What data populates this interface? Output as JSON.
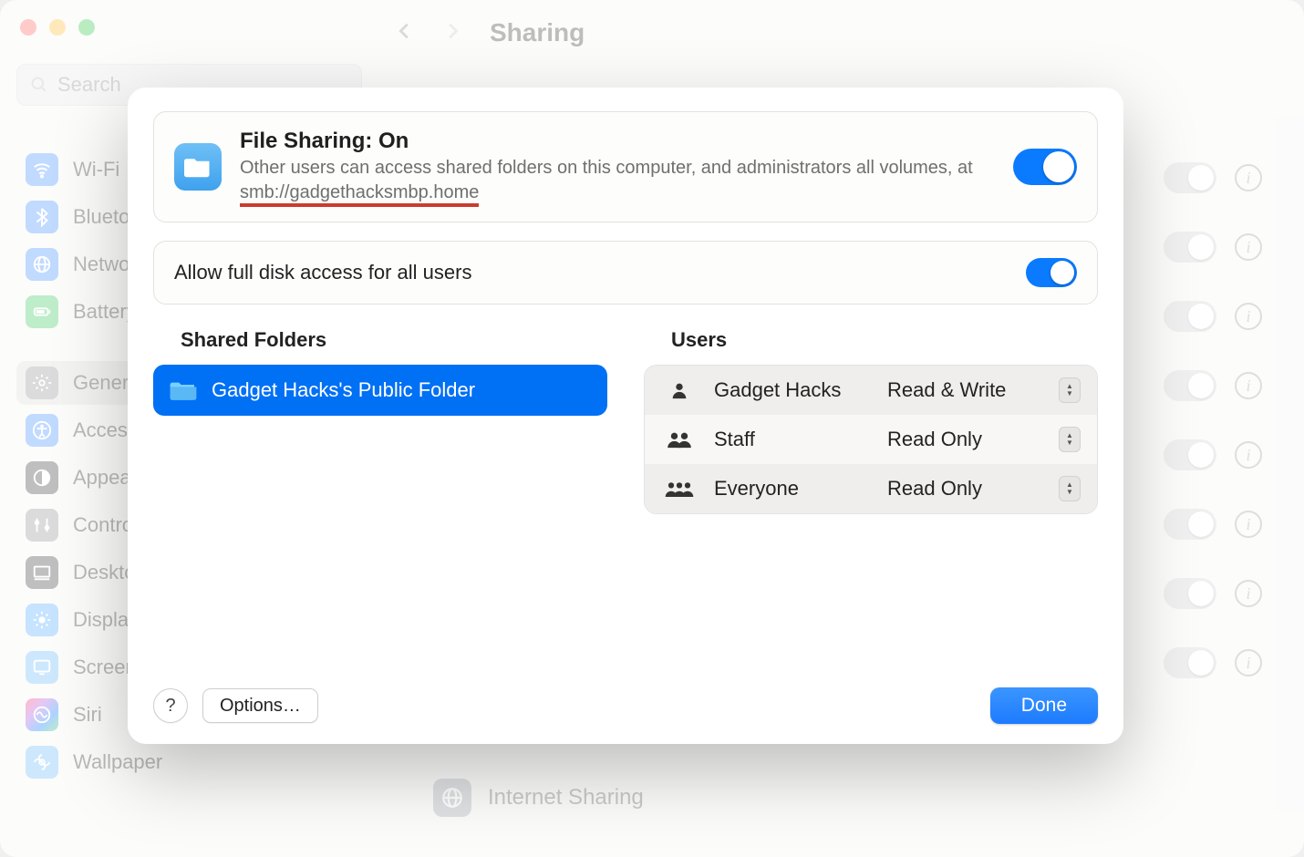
{
  "window": {
    "title": "Sharing",
    "search_placeholder": "Search"
  },
  "sidebar": {
    "items": [
      {
        "label": "Wi-Fi",
        "icon": "wifi",
        "color": "ic-blue"
      },
      {
        "label": "Bluetooth",
        "icon": "bluetooth",
        "color": "ic-blue"
      },
      {
        "label": "Network",
        "icon": "network",
        "color": "ic-blue"
      },
      {
        "label": "Battery",
        "icon": "battery",
        "color": "ic-green"
      },
      {
        "label": "General",
        "icon": "gear",
        "color": "ic-grey",
        "selected": true
      },
      {
        "label": "Accessibility",
        "icon": "accessibility",
        "color": "ic-blue"
      },
      {
        "label": "Appearance",
        "icon": "appearance",
        "color": "ic-dark"
      },
      {
        "label": "Control Center",
        "icon": "control",
        "color": "ic-grey"
      },
      {
        "label": "Desktop & Dock",
        "icon": "desktop",
        "color": "ic-dark"
      },
      {
        "label": "Displays",
        "icon": "displays",
        "color": "ic-sun"
      },
      {
        "label": "Screen Saver",
        "icon": "screensaver",
        "color": "ic-cyan"
      },
      {
        "label": "Siri",
        "icon": "siri",
        "color": "ic-siri"
      },
      {
        "label": "Wallpaper",
        "icon": "wallpaper",
        "color": "ic-cyan"
      }
    ]
  },
  "background": {
    "internet_sharing": "Internet Sharing"
  },
  "modal": {
    "file_sharing_title": "File Sharing: On",
    "file_sharing_desc_prefix": "Other users can access shared folders on this computer, and administrators all volumes, at ",
    "file_sharing_smb": "smb://gadgethacksmbp.home",
    "file_sharing_enabled": true,
    "full_disk_label": "Allow full disk access for all users",
    "full_disk_enabled": true,
    "shared_folders_title": "Shared Folders",
    "users_title": "Users",
    "shared_folders": [
      {
        "name": "Gadget Hacks's Public Folder"
      }
    ],
    "users": [
      {
        "name": "Gadget Hacks",
        "permission": "Read & Write",
        "icon": "person"
      },
      {
        "name": "Staff",
        "permission": "Read Only",
        "icon": "pair"
      },
      {
        "name": "Everyone",
        "permission": "Read Only",
        "icon": "group"
      }
    ],
    "options_label": "Options…",
    "done_label": "Done",
    "help_label": "?"
  }
}
